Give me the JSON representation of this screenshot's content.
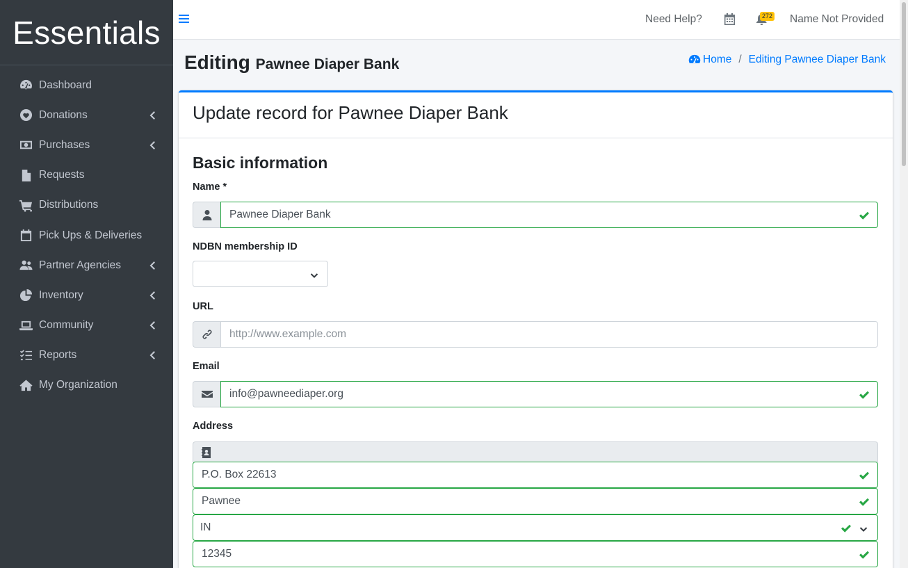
{
  "brand": {
    "name": "Essentials"
  },
  "sidebar": {
    "items": [
      {
        "label": "Dashboard",
        "icon": "tachometer-icon",
        "has_submenu": false
      },
      {
        "label": "Donations",
        "icon": "heart-icon",
        "has_submenu": true
      },
      {
        "label": "Purchases",
        "icon": "money-bill-icon",
        "has_submenu": true
      },
      {
        "label": "Requests",
        "icon": "file-icon",
        "has_submenu": false
      },
      {
        "label": "Distributions",
        "icon": "cart-icon",
        "has_submenu": false
      },
      {
        "label": "Pick Ups & Deliveries",
        "icon": "calendar-icon",
        "has_submenu": false
      },
      {
        "label": "Partner Agencies",
        "icon": "users-icon",
        "has_submenu": true
      },
      {
        "label": "Inventory",
        "icon": "pie-chart-icon",
        "has_submenu": true
      },
      {
        "label": "Community",
        "icon": "laptop-icon",
        "has_submenu": true
      },
      {
        "label": "Reports",
        "icon": "tasks-icon",
        "has_submenu": true
      },
      {
        "label": "My Organization",
        "icon": "home-icon",
        "has_submenu": false
      }
    ]
  },
  "topbar": {
    "help_label": "Need Help?",
    "notification_count": "272",
    "user_name": "Name Not Provided"
  },
  "header": {
    "title_prefix": "Editing",
    "title_org": "Pawnee Diaper Bank",
    "breadcrumb": {
      "home": "Home",
      "current": "Editing Pawnee Diaper Bank"
    }
  },
  "card": {
    "title": "Update record for Pawnee Diaper Bank",
    "section": "Basic information",
    "fields": {
      "name": {
        "label": "Name *",
        "value": "Pawnee Diaper Bank"
      },
      "ndbn": {
        "label": "NDBN membership ID",
        "value": ""
      },
      "url": {
        "label": "URL",
        "placeholder": "http://www.example.com",
        "value": ""
      },
      "email": {
        "label": "Email",
        "value": "info@pawneediaper.org"
      },
      "address": {
        "label": "Address",
        "street": "P.O. Box 22613",
        "city": "Pawnee",
        "state": "IN",
        "zip": "12345"
      }
    }
  },
  "colors": {
    "sidebar_bg": "#343a40",
    "primary": "#007bff",
    "valid": "#28a745",
    "badge": "#ffc107"
  }
}
